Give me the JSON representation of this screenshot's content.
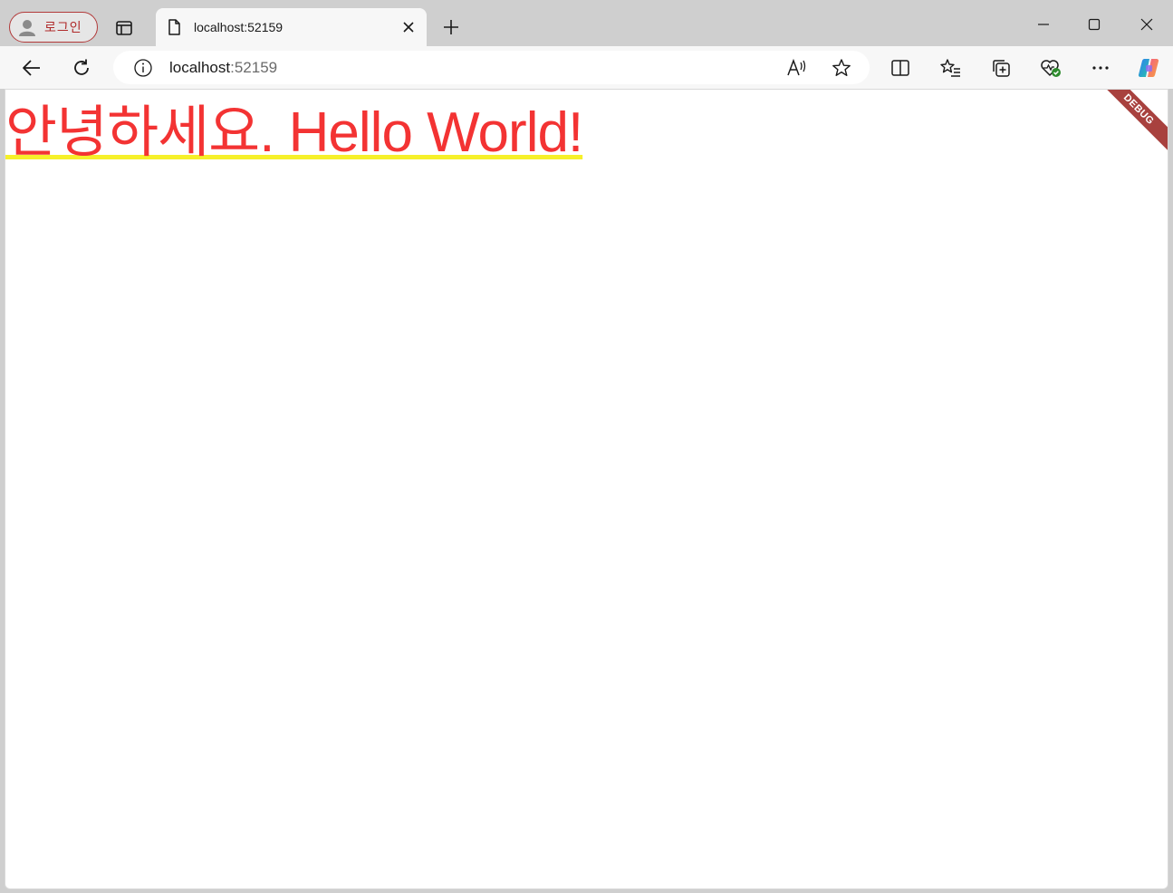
{
  "browser": {
    "profile_label": "로그인",
    "tab": {
      "title": "localhost:52159"
    },
    "address": {
      "host": "localhost",
      "port": ":52159"
    }
  },
  "page": {
    "headline": "안녕하세요. Hello World!",
    "debug_banner": "DEBUG"
  },
  "colors": {
    "headline": "#f33333",
    "underline": "#f6f02a",
    "debug_banner": "#a8413e",
    "profile_border": "#b23a3a"
  },
  "icons": {
    "profile": "person-icon",
    "tab_actions": "tab-actions-icon",
    "tab_page": "page-icon",
    "tab_close": "close-icon",
    "new_tab": "plus-icon",
    "minimize": "minimize-icon",
    "maximize": "maximize-icon",
    "close_window": "close-icon",
    "back": "back-arrow-icon",
    "refresh": "refresh-icon",
    "site_info": "info-icon",
    "read_aloud": "read-aloud-icon",
    "favorite": "star-icon",
    "split_screen": "split-screen-icon",
    "favorites": "favorites-list-icon",
    "collections": "collections-icon",
    "browser_essentials": "heart-check-icon",
    "more": "more-icon",
    "copilot": "copilot-icon"
  }
}
